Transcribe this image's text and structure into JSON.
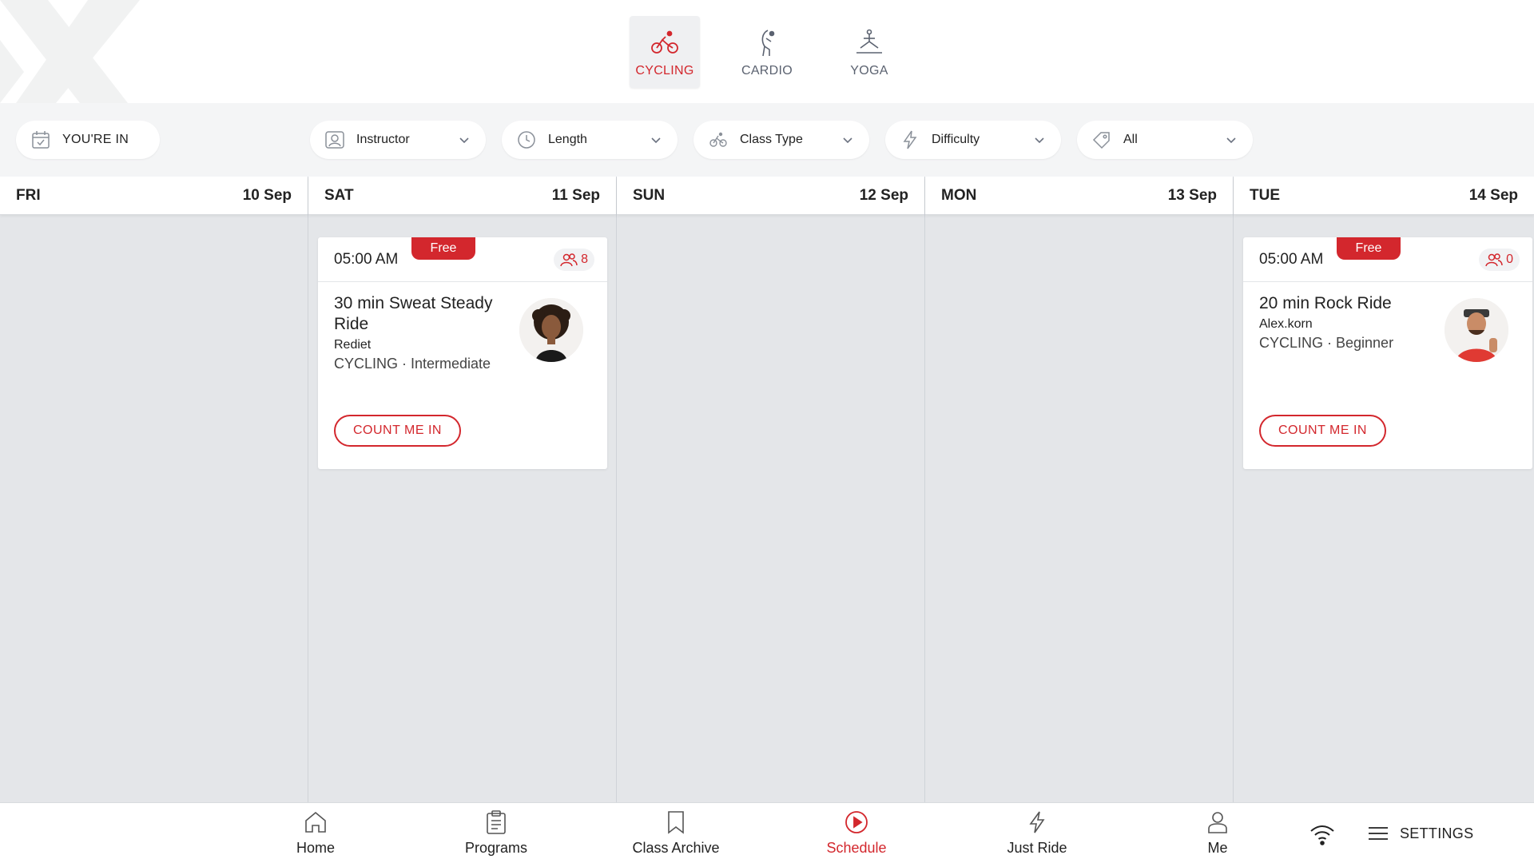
{
  "colors": {
    "accent": "#d3272d",
    "background": "#e4e6e9",
    "card": "#ffffff"
  },
  "categories": [
    {
      "label": "CYCLING",
      "icon": "cycling-icon",
      "active": true
    },
    {
      "label": "CARDIO",
      "icon": "cardio-icon",
      "active": false
    },
    {
      "label": "YOGA",
      "icon": "yoga-icon",
      "active": false
    }
  ],
  "filters": {
    "youre_in": "YOU'RE IN",
    "instructor": "Instructor",
    "length": "Length",
    "class_type": "Class Type",
    "difficulty": "Difficulty",
    "all": "All"
  },
  "days": [
    {
      "name": "FRI",
      "date": "10 Sep"
    },
    {
      "name": "SAT",
      "date": "11 Sep"
    },
    {
      "name": "SUN",
      "date": "12 Sep"
    },
    {
      "name": "MON",
      "date": "13 Sep"
    },
    {
      "name": "TUE",
      "date": "14 Sep"
    }
  ],
  "classes": {
    "sat": {
      "time": "05:00 AM",
      "badge": "Free",
      "count": "8",
      "title": "30 min Sweat Steady Ride",
      "instructor": "Rediet",
      "meta": "CYCLING · Intermediate",
      "button": "COUNT ME IN"
    },
    "tue": {
      "time": "05:00 AM",
      "badge": "Free",
      "count": "0",
      "title": "20 min Rock Ride",
      "instructor": "Alex.korn",
      "meta": "CYCLING · Beginner",
      "button": "COUNT ME IN"
    }
  },
  "nav": {
    "home": "Home",
    "programs": "Programs",
    "class_archive": "Class Archive",
    "schedule": "Schedule",
    "just_ride": "Just Ride",
    "me": "Me",
    "settings": "SETTINGS"
  }
}
